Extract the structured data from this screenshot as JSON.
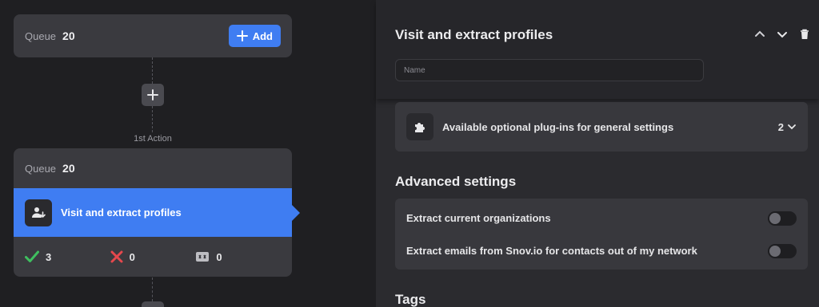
{
  "workflow": {
    "queue_card": {
      "label": "Queue",
      "count": "20",
      "add_label": "Add"
    },
    "action_label": "1st Action",
    "action_card": {
      "queue_label": "Queue",
      "queue_count": "20",
      "step_title": "Visit and extract profiles",
      "stats": [
        {
          "icon": "check-icon",
          "value": "3",
          "color": "#3fbf5f"
        },
        {
          "icon": "x-icon",
          "value": "0",
          "color": "#e5484d"
        },
        {
          "icon": "skipped-icon",
          "value": "0",
          "color": "#bdbdc2"
        }
      ]
    }
  },
  "panel": {
    "title": "Visit and extract profiles",
    "name_placeholder": "Name",
    "plugins": {
      "label": "Available optional plug-ins for general settings",
      "count": "2"
    },
    "advanced": {
      "title": "Advanced settings",
      "settings": [
        {
          "label": "Extract current organizations",
          "on": false
        },
        {
          "label": "Extract emails from Snov.io for contacts out of my network",
          "on": false
        }
      ]
    },
    "tags_title": "Tags"
  },
  "colors": {
    "accent": "#3f7df2",
    "panel_bg": "#2b2b2f",
    "card_bg": "#3a3a3f"
  }
}
